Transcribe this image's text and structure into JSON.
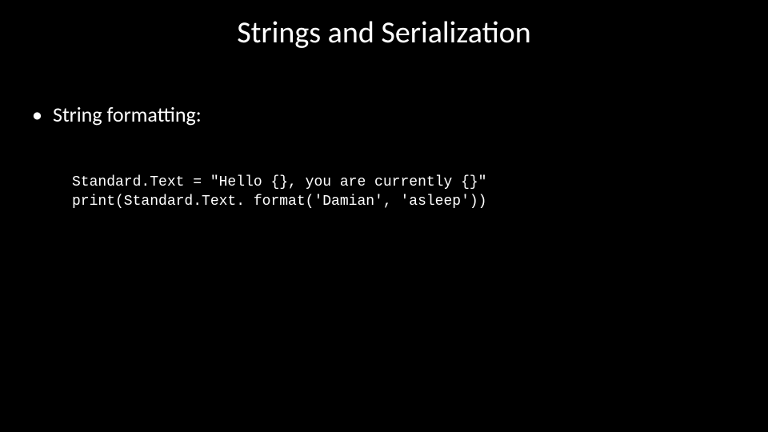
{
  "slide": {
    "title": "Strings and Serialization",
    "bullet": {
      "marker": "•",
      "text": "String formatting:"
    },
    "code": {
      "line1": "Standard.Text = \"Hello {}, you are currently {}\"",
      "line2": "print(Standard.Text. format('Damian', 'asleep'))"
    }
  }
}
